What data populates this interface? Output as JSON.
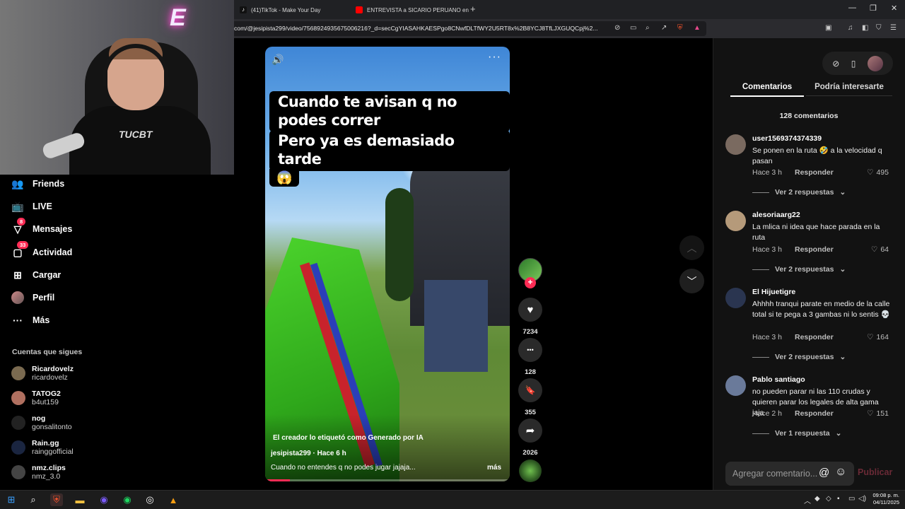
{
  "browser": {
    "tabs": [
      {
        "title": "(41)TikTok - Make Your Day",
        "icon_color": "#ffffff"
      },
      {
        "title": "ENTREVISTA a SICARIO PERUANO en",
        "icon_color": "#ff0000"
      }
    ],
    "new_tab": "+",
    "url": "com/@jesipista299/video/7568924935675006216?_d=secCgYIASAHKAESPgo8CNwfDLTfWY2U5RT8x%2B8YCJ8TfLJXGUQCpj%2..."
  },
  "nav": {
    "items": [
      {
        "label": "Friends",
        "icon": "friends-icon",
        "badge": ""
      },
      {
        "label": "LIVE",
        "icon": "live-icon",
        "badge": ""
      },
      {
        "label": "Mensajes",
        "icon": "messages-icon",
        "badge": "8"
      },
      {
        "label": "Actividad",
        "icon": "activity-icon",
        "badge": "33"
      },
      {
        "label": "Cargar",
        "icon": "upload-icon",
        "badge": ""
      },
      {
        "label": "Perfil",
        "icon": "profile-avatar",
        "badge": ""
      },
      {
        "label": "Más",
        "icon": "more-icon",
        "badge": ""
      }
    ],
    "following_title": "Cuentas que sigues",
    "following": [
      {
        "name": "Ricardovelz",
        "handle": "ricardovelz",
        "color": "#7a6a50"
      },
      {
        "name": "TATOG2",
        "handle": "b4ut159",
        "color": "#b07060"
      },
      {
        "name": "nog",
        "handle": "gonsalitonto",
        "color": "#222222"
      },
      {
        "name": "Rain.gg",
        "handle": "rainggofficial",
        "color": "#1a2540"
      },
      {
        "name": "nmz.clips",
        "handle": "nmz_3.0",
        "color": "#444444"
      }
    ]
  },
  "webcam": {
    "neon_text": "E",
    "shirt_text": "TUCBT"
  },
  "video": {
    "caption_lines": [
      "Cuando te avisan q no podes correr",
      "Pero ya es demasiado tarde"
    ],
    "caption_emoji": "😱",
    "ai_label": "El creador lo etiquetó como Generado por IA",
    "author_line": "jesipista299 · Hace 6 h",
    "description": "Cuando no entendes q no podes jugar jajaja...",
    "more": "más",
    "progress_fraction": 0.1
  },
  "actions": [
    {
      "name": "like",
      "icon": "heart-icon",
      "glyph": "♥",
      "count": "7234"
    },
    {
      "name": "comment",
      "icon": "comment-icon",
      "glyph": "•••",
      "count": "128"
    },
    {
      "name": "save",
      "icon": "bookmark-icon",
      "glyph": "🔖",
      "count": "355"
    },
    {
      "name": "share",
      "icon": "share-icon",
      "glyph": "➦",
      "count": "2026"
    }
  ],
  "panel": {
    "tabs": [
      "Comentarios",
      "Podría interesarte"
    ],
    "comment_count": "128 comentarios",
    "comments": [
      {
        "user": "user1569374374339",
        "text": "Se ponen en la ruta 🤣 a la velocidad q pasan",
        "time": "Hace 3 h",
        "reply": "Responder",
        "likes": "495",
        "replies": "Ver 2 respuestas",
        "avatar": "#7a6a60"
      },
      {
        "user": "alesoriaarg22",
        "text": "La mlica ni idea que hace parada en la ruta",
        "time": "Hace 3 h",
        "reply": "Responder",
        "likes": "64",
        "replies": "Ver 2 respuestas",
        "avatar": "#b59a7a"
      },
      {
        "user": "El Hijuetigre",
        "text": "Ahhhh tranqui parate en medio de la calle total si te pega a 3 gambas ni lo sentis 💀",
        "time": "Hace 3 h",
        "reply": "Responder",
        "likes": "164",
        "replies": "Ver 2 respuestas",
        "avatar": "#2a3550"
      },
      {
        "user": "Pablo santiago",
        "text": "no pueden parar ni las 110 crudas y quieren parar los legales de alta gama jaja",
        "time": "Hace 2 h",
        "reply": "Responder",
        "likes": "151",
        "replies": "Ver 1 respuesta",
        "avatar": "#6a7a9a"
      }
    ],
    "input_placeholder": "Agregar comentario...",
    "publish": "Publicar"
  },
  "taskbar": {
    "time": "09:08 p. m.",
    "date": "04/11/2025"
  },
  "colors": {
    "accent": "#fe2c55",
    "panel_bg": "#121212"
  }
}
